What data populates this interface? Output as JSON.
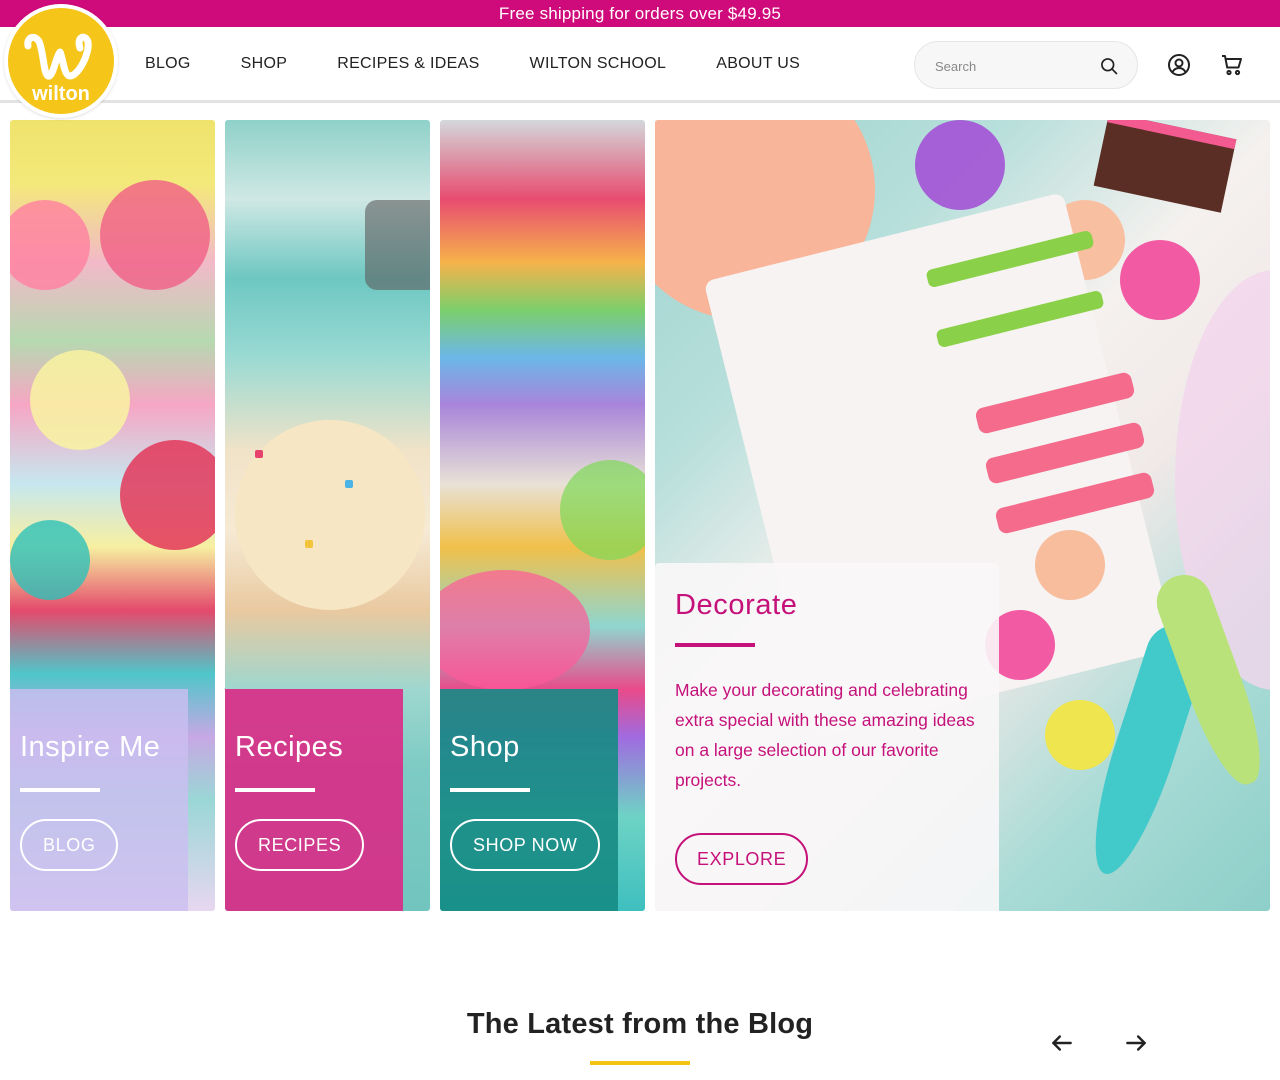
{
  "promo": {
    "text": "Free shipping for orders over $49.95"
  },
  "brand": {
    "logo_text": "wilton",
    "accent": "#cf0a7b",
    "logo_yellow": "#f5c519"
  },
  "nav": {
    "items": [
      {
        "label": "BLOG"
      },
      {
        "label": "SHOP"
      },
      {
        "label": "RECIPES & IDEAS"
      },
      {
        "label": "WILTON SCHOOL"
      },
      {
        "label": "ABOUT US"
      }
    ]
  },
  "search": {
    "placeholder": "Search",
    "value": ""
  },
  "icons": {
    "search": "search-icon",
    "account": "user-account-icon",
    "cart": "shopping-cart-icon",
    "prev": "arrow-left-icon",
    "next": "arrow-right-icon"
  },
  "hero": {
    "inspire": {
      "title": "Inspire Me",
      "button": "BLOG"
    },
    "recipes": {
      "title": "Recipes",
      "button": "RECIPES"
    },
    "shop": {
      "title": "Shop",
      "button": "SHOP NOW"
    },
    "decorate": {
      "title": "Decorate",
      "description": "Make your decorating and celebrating extra special with these amazing ideas on a large selection of our favorite projects.",
      "button": "EXPLORE"
    }
  },
  "blog": {
    "title": "The Latest from the Blog"
  }
}
